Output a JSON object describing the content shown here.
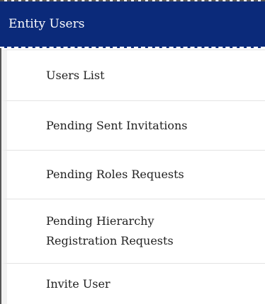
{
  "header": {
    "title": "Entity Users"
  },
  "menu": {
    "items": [
      {
        "label": "Users List"
      },
      {
        "label": "Pending Sent Invitations"
      },
      {
        "label": "Pending Roles Requests"
      },
      {
        "label": "Pending Hierarchy\nRegistration Requests"
      },
      {
        "label": "Invite User"
      }
    ]
  },
  "colors": {
    "header_bg": "#0b2a7a",
    "header_text": "#ffffff",
    "item_text": "#222222"
  }
}
